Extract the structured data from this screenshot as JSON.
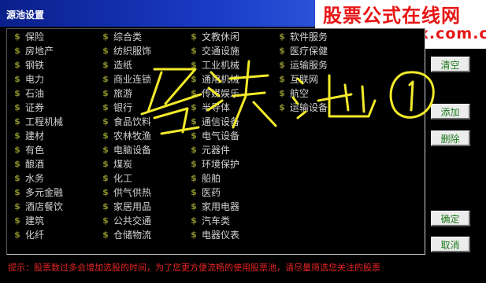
{
  "window": {
    "title": "源池设置"
  },
  "watermark": {
    "line1": "股票公式在线网",
    "line2": "www.gszx.com.cn"
  },
  "icon_glyph": "$",
  "columns": [
    [
      "保险",
      "房地产",
      "钢铁",
      "电力",
      "石油",
      "证券",
      "工程机械",
      "建材",
      "有色",
      "酿酒",
      "水务",
      "多元金融",
      "酒店餐饮",
      "建筑",
      "化纤"
    ],
    [
      "综合类",
      "纺织服饰",
      "造纸",
      "商业连锁",
      "旅游",
      "银行",
      "食品饮料",
      "农林牧渔",
      "电脑设备",
      "煤炭",
      "化工",
      "供气供热",
      "家居用品",
      "公共交通",
      "仓储物流"
    ],
    [
      "文教休闲",
      "交通设施",
      "工业机械",
      "通用机械",
      "传媒娱乐",
      "半导体",
      "通信设备",
      "电气设备",
      "元器件",
      "环境保护",
      "船舶",
      "医药",
      "家用电器",
      "汽车类",
      "电器仪表"
    ],
    [
      "软件服务",
      "医疗保健",
      "运输服务",
      "互联网",
      "航空",
      "运输设备"
    ]
  ],
  "buttons": {
    "clear": "清空",
    "add": "添加",
    "delete": "删除",
    "confirm": "确定",
    "cancel": "取消"
  },
  "hint": "提示：股票数过多会增加选股的时间，为了您更方便流畅的使用股票池，请尽量筛选您关注的股票",
  "colors": {
    "title_bar": "#1a3cc8",
    "item_icon": "#8a8f2a",
    "item_text": "#d2d2d2",
    "button_text": "#1b7a1b",
    "hint_text": "#e82424",
    "watermark_text": "#e81515",
    "scribble": "#f2ea2a"
  }
}
